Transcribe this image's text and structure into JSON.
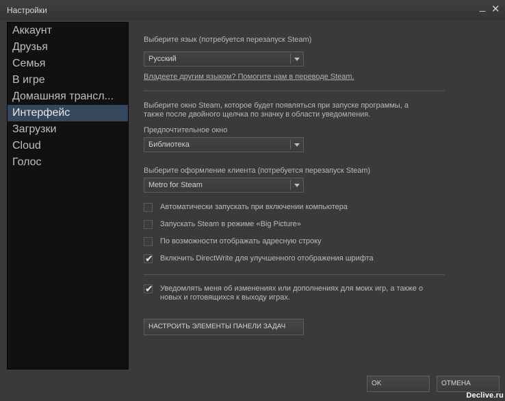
{
  "window": {
    "title": "Настройки"
  },
  "sidebar": {
    "items": [
      {
        "label": "Аккаунт"
      },
      {
        "label": "Друзья"
      },
      {
        "label": "Семья"
      },
      {
        "label": "В игре"
      },
      {
        "label": "Домашняя трансл..."
      },
      {
        "label": "Интерфейс"
      },
      {
        "label": "Загрузки"
      },
      {
        "label": "Cloud"
      },
      {
        "label": "Голос"
      }
    ],
    "active": "Интерфейс"
  },
  "language": {
    "label": "Выберите язык (потребуется перезапуск Steam)",
    "value": "Русский",
    "help_link": "Владеете другим языком? Помогите нам в переводе Steam."
  },
  "startup_window": {
    "description_line1": "Выберите окно Steam, которое будет появляться при запуске программы, а",
    "description_line2": "также после двойного щелчка по значку в области уведомления.",
    "label": "Предпочтительное окно",
    "value": "Библиотека"
  },
  "skin": {
    "label": "Выберите оформление клиента (потребуется перезапуск Steam)",
    "value": "Metro for Steam"
  },
  "options": [
    {
      "label": "Автоматически запускать при включении компьютера",
      "checked": false
    },
    {
      "label": "Запускать Steam в режиме «Big Picture»",
      "checked": false
    },
    {
      "label": "По возможности отображать адресную строку",
      "checked": false
    },
    {
      "label": "Включить DirectWrite для улучшенного отображения шрифта",
      "checked": true
    }
  ],
  "notify": {
    "line1": "Уведомлять меня об изменениях или дополнениях для моих игр, а также о",
    "line2": "новых и готовящихся к выходу играх.",
    "checked": true
  },
  "taskbar_button": "НАСТРОИТЬ ЭЛЕМЕНТЫ ПАНЕЛИ ЗАДАЧ",
  "footer": {
    "ok": "OK",
    "cancel": "ОТМЕНА"
  },
  "watermark": "Declive.ru",
  "icons": {
    "minimize": "minimize-icon",
    "close": "close-icon",
    "check": "checkmark-icon",
    "dropdown": "chevron-down-icon"
  }
}
